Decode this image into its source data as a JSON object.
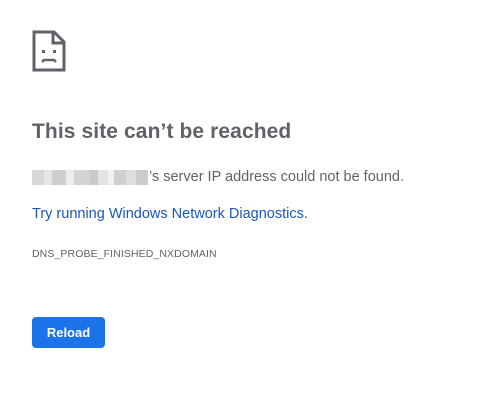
{
  "icon": {
    "name": "sad-page-icon",
    "color": "#5f6368"
  },
  "error": {
    "title": "This site can’t be reached",
    "host_redacted": true,
    "message_suffix": "’s server IP address could not be found.",
    "diagnostics_link": "Try running Windows Network Diagnostics",
    "diagnostics_suffix": ".",
    "code": "DNS_PROBE_FINISHED_NXDOMAIN"
  },
  "actions": {
    "reload_label": "Reload"
  },
  "colors": {
    "text": "#5f6368",
    "link": "#1a56c4",
    "button": "#1a73e8",
    "button_text": "#ffffff"
  }
}
